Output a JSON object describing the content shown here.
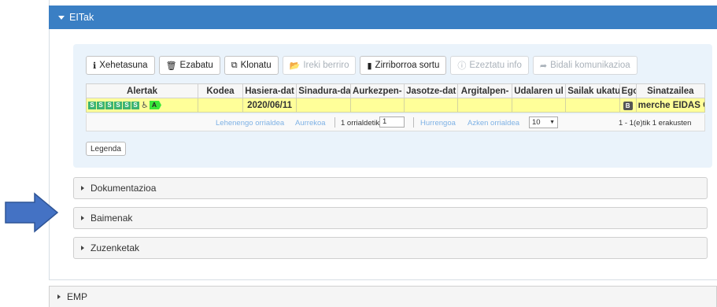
{
  "section": {
    "title": "EITak"
  },
  "toolbar": {
    "buttons": [
      {
        "label": "Xehetasuna",
        "icon": "info-icon",
        "glyph": "ℹ",
        "disabled": false
      },
      {
        "label": "Ezabatu",
        "icon": "trash-icon",
        "glyph": "🗑",
        "disabled": false
      },
      {
        "label": "Klonatu",
        "icon": "copy-icon",
        "glyph": "⧉",
        "disabled": false
      },
      {
        "label": "Ireki berriro",
        "icon": "folder-open-icon",
        "glyph": "📂",
        "disabled": true
      },
      {
        "label": "Zirriborroa sortu",
        "icon": "file-icon",
        "glyph": "▮",
        "disabled": false
      },
      {
        "label": "Ezeztatu info",
        "icon": "info-circle-icon",
        "glyph": "ⓘ",
        "disabled": true
      },
      {
        "label": "Bidali komunikazioa",
        "icon": "share-icon",
        "glyph": "➦",
        "disabled": true
      }
    ]
  },
  "grid": {
    "columns": [
      "Alertak",
      "Kodea",
      "Hasiera-dat",
      "Sinadura-da",
      "Aurkezpen-",
      "Jasotze-dat",
      "Argitalpen-",
      "Udalaren ul",
      "Sailak ukatu",
      "Egoe",
      "Sinatzailea"
    ],
    "row": {
      "alert_badges": [
        "S",
        "S",
        "S",
        "S",
        "S",
        "S"
      ],
      "alert_a": "A",
      "kodea": "",
      "hasiera_data": "2020/06/11",
      "egoera": "B",
      "sinatzailea": "merche EIDAS CE"
    }
  },
  "pager": {
    "first": "Lehenengo orrialdea",
    "prev": "Aurrekoa",
    "page_label": "1 orrialdetik",
    "page_value": "1",
    "next": "Hurrengoa",
    "last": "Azken orrialdea",
    "page_size": "10",
    "summary": "1 - 1(e)tik 1 erakusten"
  },
  "legend_button": "Legenda",
  "accordions": [
    "Dokumentazioa",
    "Baimenak",
    "Zuzenketak"
  ],
  "emp": "EMP",
  "colors": {
    "header": "#3a7fc4",
    "row_highlight": "#ffff99",
    "arrow": "#4472c4"
  }
}
